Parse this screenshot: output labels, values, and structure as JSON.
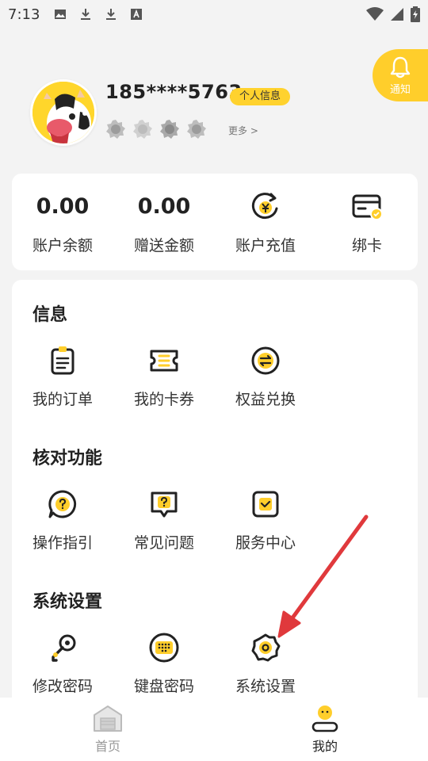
{
  "status_bar": {
    "time": "7:13"
  },
  "notify": {
    "label": "通知"
  },
  "profile": {
    "phone": "185****5763",
    "info_badge": "个人信息",
    "more": "更多 >"
  },
  "wallet": {
    "balance_value": "0.00",
    "balance_label": "账户余额",
    "gift_value": "0.00",
    "gift_label": "赠送金额",
    "recharge_label": "账户充值",
    "bindcard_label": "绑卡"
  },
  "sections": {
    "info": {
      "title": "信息",
      "items": [
        "我的订单",
        "我的卡券",
        "权益兑换"
      ]
    },
    "verify": {
      "title": "核对功能",
      "items": [
        "操作指引",
        "常见问题",
        "服务中心"
      ]
    },
    "settings": {
      "title": "系统设置",
      "items": [
        "修改密码",
        "键盘密码",
        "系统设置"
      ]
    }
  },
  "bottom_nav": {
    "home": "首页",
    "mine": "我的"
  },
  "colors": {
    "accent": "#ffce2b",
    "arrow": "#e0393c"
  }
}
